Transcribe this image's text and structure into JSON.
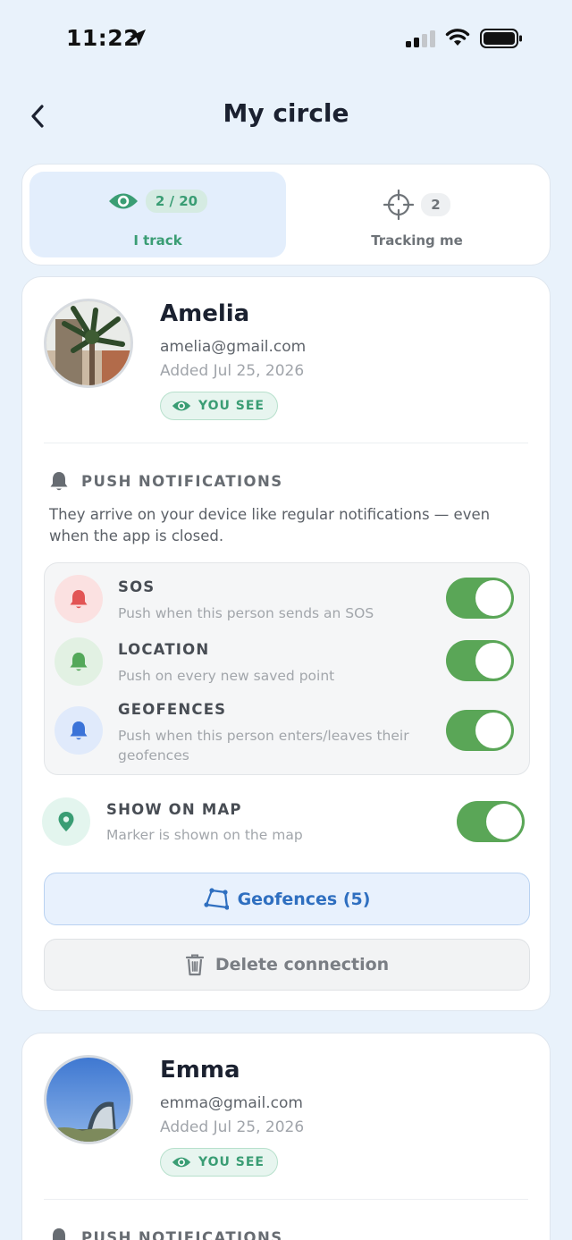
{
  "status_bar": {
    "time": "11:22"
  },
  "header": {
    "title": "My circle"
  },
  "tabs": [
    {
      "count": "2 / 20",
      "label": "I track",
      "active": true,
      "icon": "eye-icon"
    },
    {
      "count": "2",
      "label": "Tracking me",
      "active": false,
      "icon": "crosshair-icon"
    }
  ],
  "people": [
    {
      "name": "Amelia",
      "email": "amelia@gmail.com",
      "added": "Added Jul 25, 2026",
      "badge": "YOU SEE",
      "push_section": {
        "title": "PUSH NOTIFICATIONS",
        "description": "They arrive on your device like regular notifications — even when the app is closed."
      },
      "notifications": [
        {
          "title": "SOS",
          "desc": "Push when this person sends an SOS",
          "enabled": true,
          "color": "#e25555"
        },
        {
          "title": "LOCATION",
          "desc": "Push on every new saved point",
          "enabled": true,
          "color": "#54a85a"
        },
        {
          "title": "GEOFENCES",
          "desc": "Push when this person enters/leaves their geofences",
          "enabled": true,
          "color": "#3b73d8"
        }
      ],
      "show_on_map": {
        "title": "SHOW ON MAP",
        "desc": "Marker is shown on the map",
        "enabled": true
      },
      "geofences_button": "Geofences (5)",
      "delete_button": "Delete connection"
    },
    {
      "name": "Emma",
      "email": "emma@gmail.com",
      "added": "Added Jul 25, 2026",
      "badge": "YOU SEE",
      "push_section": {
        "title": "PUSH NOTIFICATIONS"
      }
    }
  ],
  "colors": {
    "accent_green": "#3a9d74",
    "toggle_on": "#5aa657",
    "link_blue": "#2f6fc0",
    "background": "#e9f2fb"
  }
}
